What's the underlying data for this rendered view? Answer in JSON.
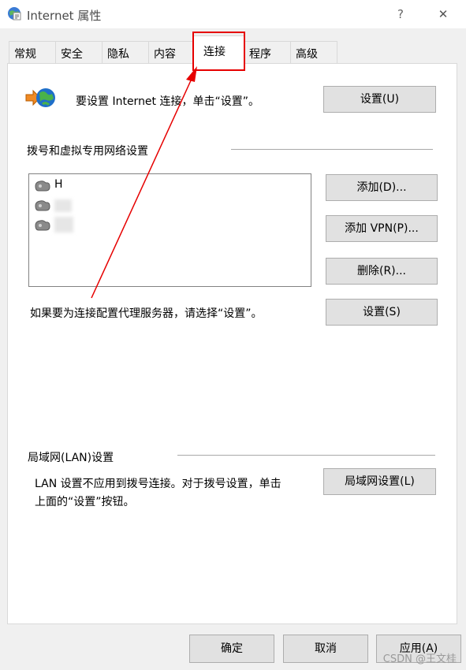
{
  "window": {
    "title": "Internet 属性",
    "help_label": "?",
    "close_label": "✕",
    "icon": "internet-options-icon"
  },
  "tabs": [
    {
      "label": "常规",
      "active": false
    },
    {
      "label": "安全",
      "active": false
    },
    {
      "label": "隐私",
      "active": false
    },
    {
      "label": "内容",
      "active": false
    },
    {
      "label": "连接",
      "active": true
    },
    {
      "label": "程序",
      "active": false
    },
    {
      "label": "高级",
      "active": false
    }
  ],
  "setup": {
    "icon": "internet-setup-globe-icon",
    "text": "要设置 Internet 连接，单击“设置”。",
    "button": "设置(U)"
  },
  "dialup": {
    "section_label": "拨号和虚拟专用网络设置",
    "connections": [
      {
        "label": "H",
        "icon": "dialup-connection-icon"
      },
      {
        "label": "",
        "icon": "dialup-connection-icon",
        "redacted": true
      },
      {
        "label": "",
        "icon": "dialup-connection-icon",
        "redacted": true
      }
    ],
    "add_button": "添加(D)...",
    "add_vpn_button": "添加 VPN(P)...",
    "delete_button": "删除(R)...",
    "proxy_text": "如果要为连接配置代理服务器，请选择“设置”。",
    "settings_button": "设置(S)"
  },
  "lan": {
    "section_label": "局域网(LAN)设置",
    "text_line1": "LAN 设置不应用到拨号连接。对于拨号设置，单击",
    "text_line2": "上面的“设置”按钮。",
    "button": "局域网设置(L)"
  },
  "footer": {
    "ok_button": "确定",
    "cancel_button": "取消",
    "apply_button": "应用(A)"
  },
  "annotation": {
    "highlight_color": "#e60000"
  },
  "watermark": "CSDN @王文桂"
}
